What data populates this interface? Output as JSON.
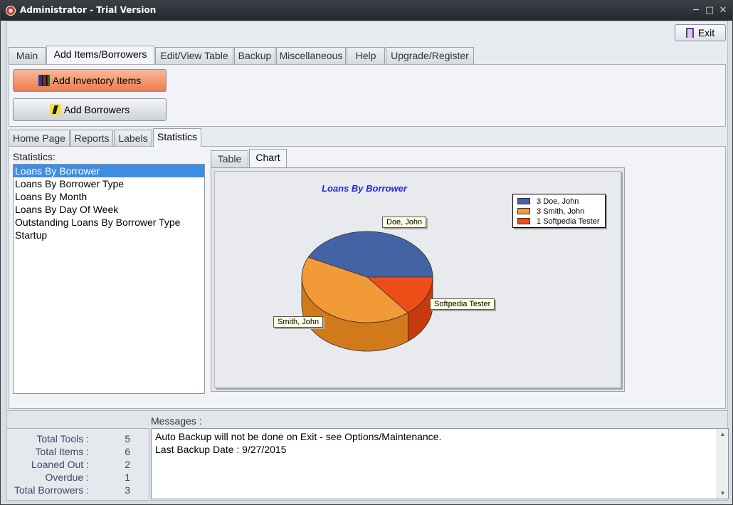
{
  "window": {
    "title": "Administrator - Trial Version",
    "controls": [
      "─",
      "□",
      "✕"
    ]
  },
  "toolbar": {
    "exit_label": "Exit"
  },
  "main_tabs": [
    {
      "label": "Main"
    },
    {
      "label": "Add Items/Borrowers",
      "active": true
    },
    {
      "label": "Edit/View Table"
    },
    {
      "label": "Backup"
    },
    {
      "label": "Miscellaneous"
    },
    {
      "label": "Help"
    },
    {
      "label": "Upgrade/Register"
    }
  ],
  "actions": {
    "add_inventory": "Add Inventory Items",
    "add_borrowers": "Add Borrowers"
  },
  "sub_tabs": [
    {
      "label": "Home Page"
    },
    {
      "label": "Reports"
    },
    {
      "label": "Labels"
    },
    {
      "label": "Statistics",
      "active": true
    }
  ],
  "statistics": {
    "label": "Statistics:",
    "items": [
      {
        "label": "Loans By Borrower",
        "selected": true
      },
      {
        "label": "Loans By Borrower Type"
      },
      {
        "label": "Loans By Month"
      },
      {
        "label": "Loans By Day Of Week"
      },
      {
        "label": "Outstanding Loans By Borrower Type"
      },
      {
        "label": "Startup"
      }
    ]
  },
  "chart_tabs": [
    {
      "label": "Table"
    },
    {
      "label": "Chart",
      "active": true
    }
  ],
  "chart_data": {
    "type": "pie",
    "title": "Loans By Borrower",
    "categories": [
      "Doe, John",
      "Smith, John",
      "Softpedia Tester"
    ],
    "values": [
      3,
      3,
      1
    ],
    "colors": [
      "#4463a5",
      "#f29a38",
      "#ef4d17"
    ],
    "side_colors": [
      "#2f4577",
      "#d17a1c",
      "#c63a0e"
    ],
    "legend": [
      {
        "value": "3",
        "name": "Doe, John"
      },
      {
        "value": "3",
        "name": "Smith, John"
      },
      {
        "value": "1",
        "name": "Softpedia Tester"
      }
    ],
    "legend_position": "top-right",
    "style": "3d"
  },
  "messages": {
    "label": "Messages :",
    "lines": [
      "Auto Backup will not be done on Exit - see Options/Maintenance.",
      "Last Backup Date : 9/27/2015"
    ]
  },
  "totals": [
    {
      "label": "Total Tools :",
      "value": "5"
    },
    {
      "label": "Total Items :",
      "value": "6"
    },
    {
      "label": "Loaned Out :",
      "value": "2"
    },
    {
      "label": "Overdue :",
      "value": "1"
    },
    {
      "label": "Total Borrowers :",
      "value": "3"
    }
  ]
}
